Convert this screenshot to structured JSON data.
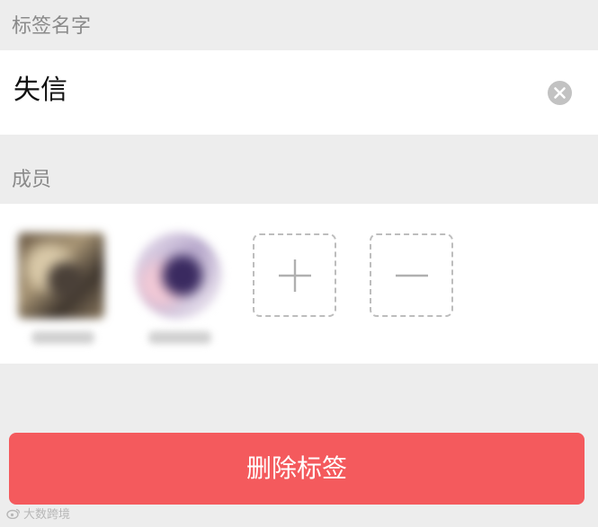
{
  "sections": {
    "tag_name_label": "标签名字",
    "members_label": "成员"
  },
  "tag_name": {
    "value": "失信"
  },
  "icons": {
    "clear": "close-circle-icon",
    "add": "plus-icon",
    "remove": "minus-icon"
  },
  "actions": {
    "delete_label": "删除标签"
  },
  "watermark": {
    "text": "大数跨境"
  },
  "colors": {
    "page_bg": "#ededed",
    "delete_button_bg": "#f45a5d",
    "section_label": "#8a8a8a"
  }
}
